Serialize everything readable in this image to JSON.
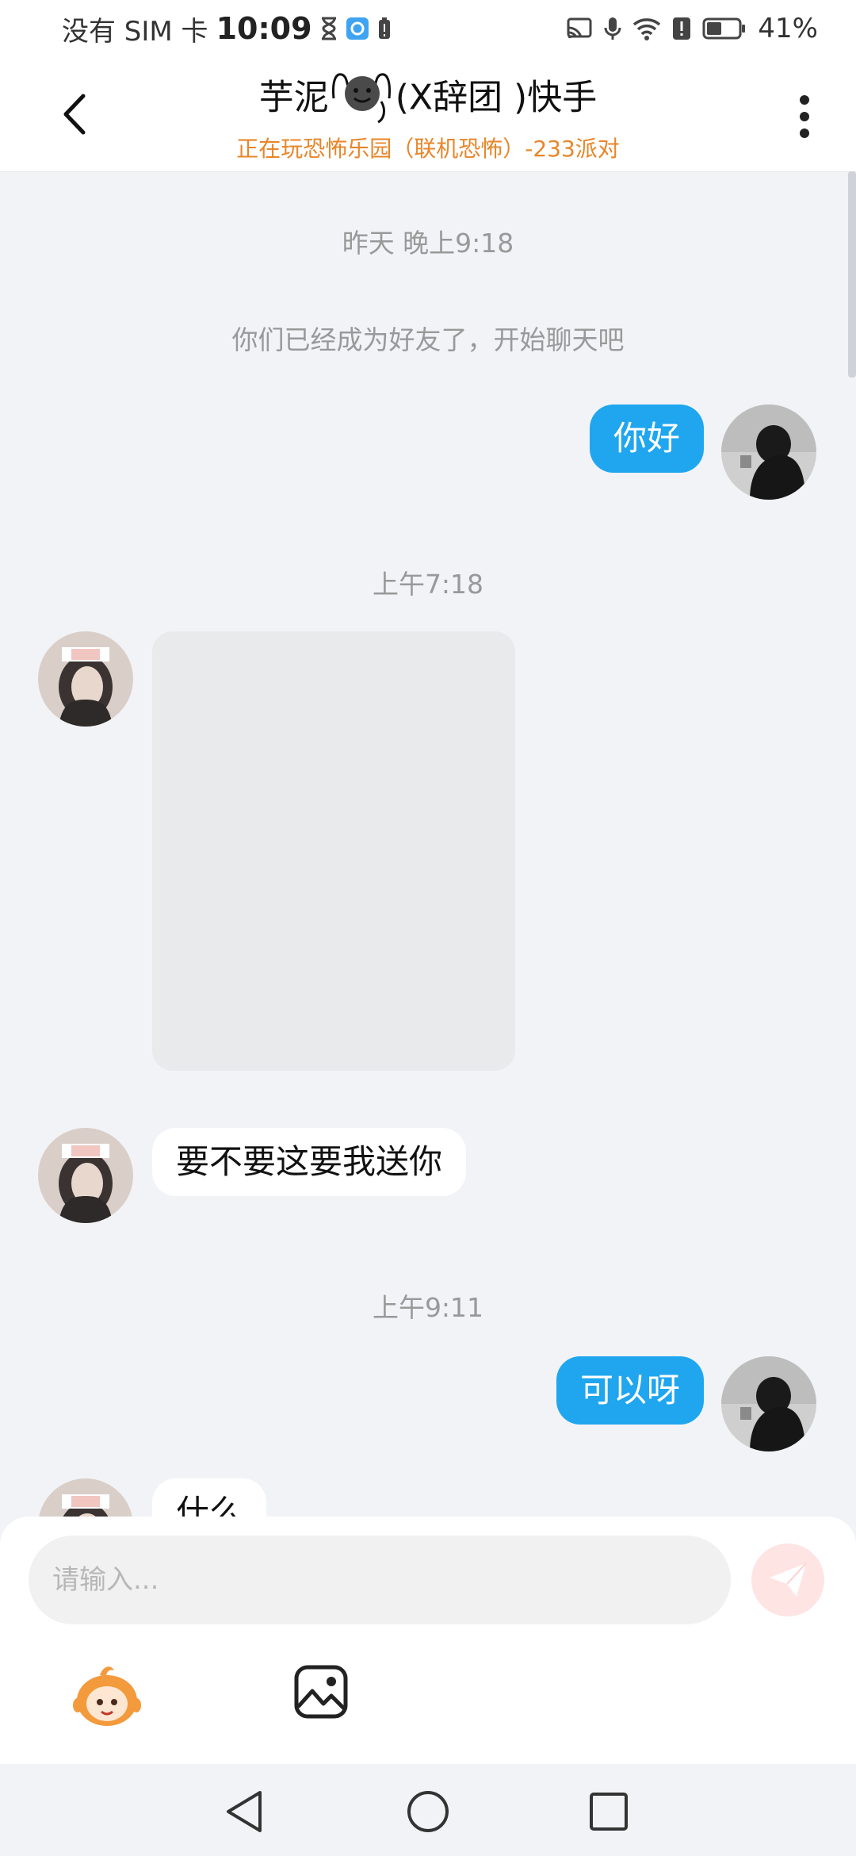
{
  "status_bar": {
    "carrier": "没有 SIM 卡",
    "time": "10:09",
    "battery_percent": "41%",
    "icons": [
      "hourglass-icon",
      "app-notification-icon",
      "battery-alert-icon",
      "cast-icon",
      "mic-icon",
      "wifi-icon",
      "alert-icon",
      "battery-icon"
    ]
  },
  "header": {
    "title_part1": "芋泥",
    "title_part2": "(X辞团 )快手",
    "subtitle": "正在玩恐怖乐园（联机恐怖）-233派对"
  },
  "messages": [
    {
      "type": "timestamp",
      "text": "昨天 晚上9:18"
    },
    {
      "type": "system",
      "text": "你们已经成为好友了，开始聊天吧"
    },
    {
      "type": "text",
      "sender": "me",
      "text": "你好"
    },
    {
      "type": "timestamp",
      "text": "上午7:18"
    },
    {
      "type": "image",
      "sender": "them"
    },
    {
      "type": "text",
      "sender": "them",
      "text": "要不要这要我送你"
    },
    {
      "type": "timestamp",
      "text": "上午9:11"
    },
    {
      "type": "text",
      "sender": "me",
      "text": "可以呀"
    },
    {
      "type": "text",
      "sender": "them",
      "text": "什么"
    }
  ],
  "input": {
    "placeholder": "请输入...",
    "value": ""
  },
  "colors": {
    "accent": "#1fa6ef",
    "subtitle": "#e8862a",
    "background": "#f2f3f7"
  }
}
